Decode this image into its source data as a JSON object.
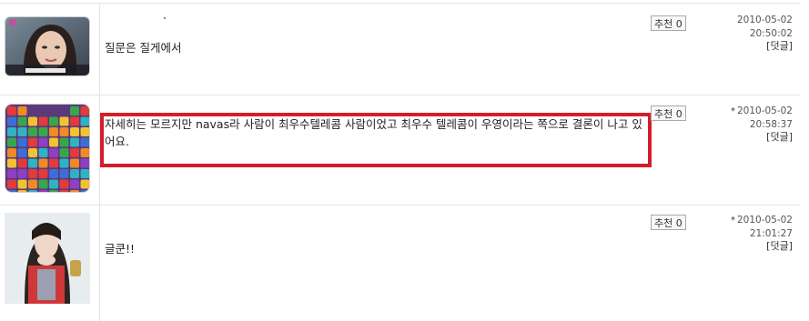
{
  "comments": [
    {
      "text": "질문은 질게에서",
      "recommend_label": "추천 0",
      "date": "2010-05-02",
      "time": "20:50:02",
      "reply_label": "[덧글]",
      "starred": false
    },
    {
      "text": "자세히는 모르지만 navas라 사람이 최우수텔레콤 사람이었고 최우수 텔레콤이 우영이라는 쪽으로 결론이 나고 있어요.",
      "recommend_label": "추천 0",
      "date": "2010-05-02",
      "time": "20:58:37",
      "reply_label": "[덧글]",
      "starred": true,
      "highlighted": true
    },
    {
      "text": "글쿤!!",
      "recommend_label": "추천 0",
      "date": "2010-05-02",
      "time": "21:01:27",
      "reply_label": "[덧글]",
      "starred": true
    }
  ],
  "star_glyph": "*",
  "colors": {
    "highlight_border": "#d31e2a",
    "divider": "#e6e6e6"
  }
}
